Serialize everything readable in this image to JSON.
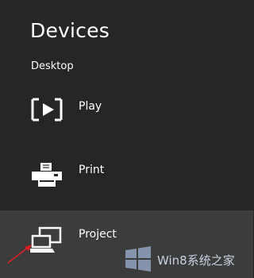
{
  "panel": {
    "title": "Devices",
    "section_label": "Desktop",
    "items": [
      {
        "label": "Play",
        "icon": "play-to-device-icon"
      },
      {
        "label": "Print",
        "icon": "printer-icon"
      },
      {
        "label": "Project",
        "icon": "project-screen-icon"
      }
    ]
  },
  "watermark": {
    "text": "Win8系统之家"
  },
  "colors": {
    "background": "#262626",
    "selected_item": "#3c3c3c",
    "text": "#ffffff",
    "arrow": "#e02020"
  }
}
